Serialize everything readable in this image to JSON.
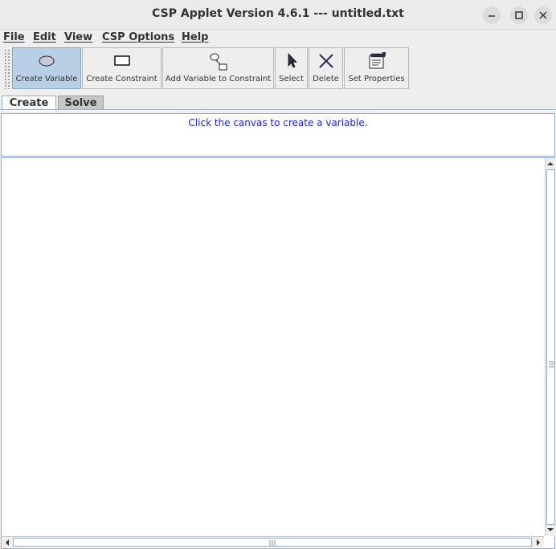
{
  "window": {
    "title": "CSP Applet Version 4.6.1 --- untitled.txt"
  },
  "menubar": {
    "items": [
      {
        "label": "File"
      },
      {
        "label": "Edit"
      },
      {
        "label": "View"
      },
      {
        "label": "CSP Options"
      },
      {
        "label": "Help"
      }
    ]
  },
  "toolbar": {
    "buttons": [
      {
        "label": "Create Variable",
        "icon": "ellipse-icon",
        "active": true
      },
      {
        "label": "Create Constraint",
        "icon": "rectangle-icon",
        "active": false
      },
      {
        "label": "Add Variable to Constraint",
        "icon": "connect-icon",
        "active": false
      },
      {
        "label": "Select",
        "icon": "pointer-icon",
        "active": false
      },
      {
        "label": "Delete",
        "icon": "x-icon",
        "active": false
      },
      {
        "label": "Set Properties",
        "icon": "properties-icon",
        "active": false
      }
    ]
  },
  "tabs": [
    {
      "label": "Create",
      "selected": true
    },
    {
      "label": "Solve",
      "selected": false
    }
  ],
  "message": {
    "text": "Click the canvas to create a variable.",
    "color": "#2222cc"
  },
  "colors": {
    "active_button": "#b8cfe5",
    "border_accent": "#9aaec4"
  }
}
